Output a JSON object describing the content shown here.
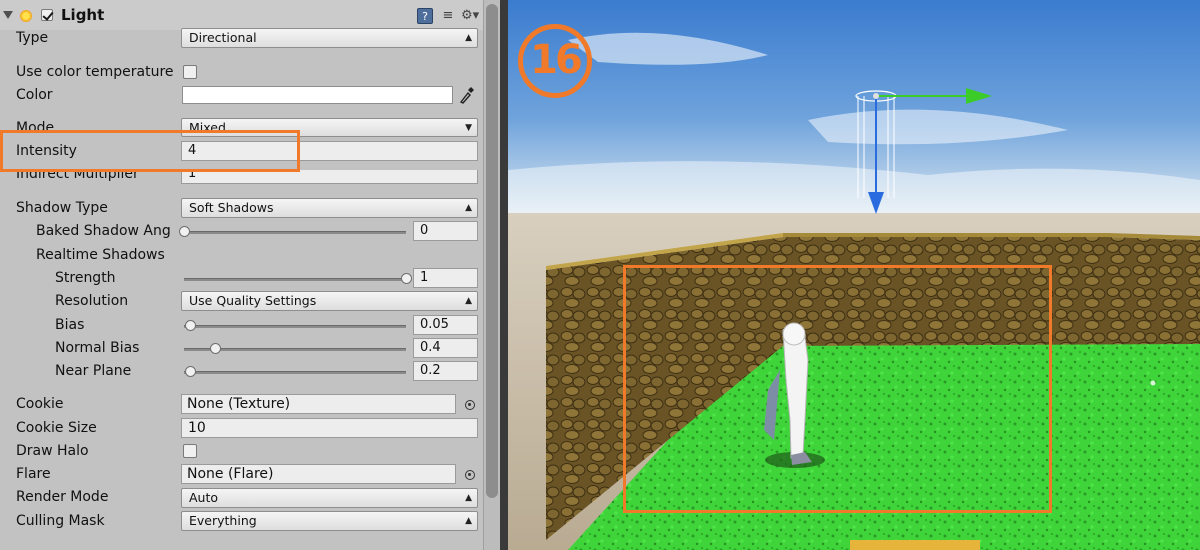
{
  "component": {
    "title": "Light",
    "enabled": true,
    "icons": [
      "help-book-icon",
      "preset-sliders-icon",
      "settings-gear-icon"
    ]
  },
  "fields": {
    "type": {
      "label": "Type",
      "value": "Directional"
    },
    "use_color_temperature": {
      "label": "Use color temperature",
      "checked": false
    },
    "color": {
      "label": "Color",
      "value": "#ffffff"
    },
    "mode": {
      "label": "Mode",
      "value": "Mixed"
    },
    "intensity": {
      "label": "Intensity",
      "value": "4"
    },
    "indirect_multiplier": {
      "label": "Indirect Multiplier",
      "value": "1"
    },
    "shadow_type": {
      "label": "Shadow Type",
      "value": "Soft Shadows"
    },
    "baked_shadow_angle": {
      "label": "Baked Shadow Ang",
      "value": "0",
      "fraction": 0.0
    },
    "realtime_shadows": {
      "label": "Realtime Shadows"
    },
    "strength": {
      "label": "Strength",
      "value": "1",
      "fraction": 1.0
    },
    "resolution": {
      "label": "Resolution",
      "value": "Use Quality Settings"
    },
    "bias": {
      "label": "Bias",
      "value": "0.05",
      "fraction": 0.02
    },
    "normal_bias": {
      "label": "Normal Bias",
      "value": "0.4",
      "fraction": 0.13
    },
    "near_plane": {
      "label": "Near Plane",
      "value": "0.2",
      "fraction": 0.02
    },
    "cookie": {
      "label": "Cookie",
      "value": "None (Texture)"
    },
    "cookie_size": {
      "label": "Cookie Size",
      "value": "10"
    },
    "draw_halo": {
      "label": "Draw Halo",
      "checked": false
    },
    "flare": {
      "label": "Flare",
      "value": "None (Flare)"
    },
    "render_mode": {
      "label": "Render Mode",
      "value": "Auto"
    },
    "culling_mask": {
      "label": "Culling Mask",
      "value": "Everything"
    }
  },
  "annotation": {
    "step_number": "16",
    "highlight_color": "#f07a2a"
  },
  "scene": {
    "sky_top": "#3f7fd0",
    "sky_bottom": "#cfe0ee",
    "ground": "#c9bfae",
    "grass": "#3fd93a",
    "wall": "#6b5524",
    "gizmo_forward": "#2a6be0",
    "gizmo_side": "#3ccc2a"
  }
}
